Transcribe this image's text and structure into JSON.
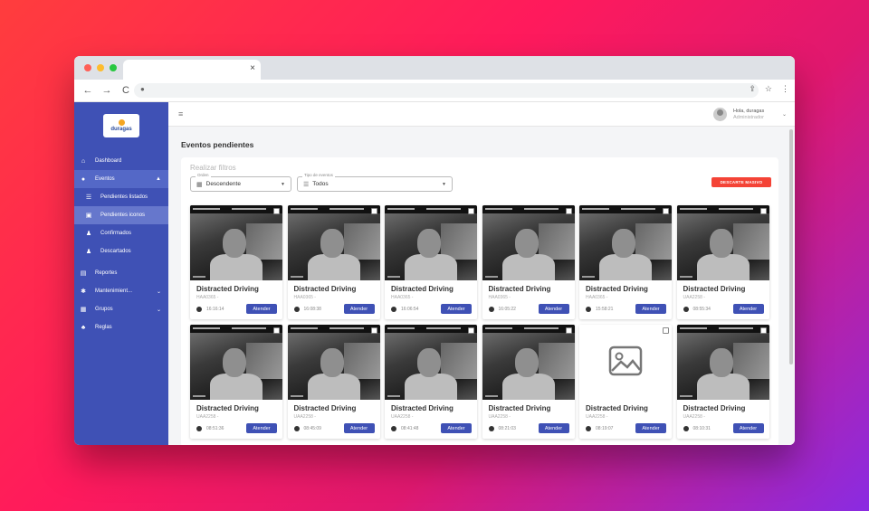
{
  "browser": {
    "tab_close": "×",
    "nav": {
      "back": "←",
      "forward": "→",
      "reload": "C"
    },
    "url_icons": {
      "share": "⇪",
      "star": "☆",
      "menu": "⋮"
    },
    "lock": "🔒"
  },
  "sidebar": {
    "logo_text": "duragas",
    "items": [
      {
        "label": "Dashboard",
        "icon": "home-icon",
        "glyph": "⌂"
      },
      {
        "label": "Eventos",
        "icon": "bell-icon",
        "glyph": "●",
        "chevron": "▲"
      },
      {
        "label": "Pendientes listados",
        "icon": "list-icon",
        "glyph": "☰"
      },
      {
        "label": "Pendientes iconos",
        "icon": "image-icon",
        "glyph": "▣"
      },
      {
        "label": "Confirmados",
        "icon": "user-check-icon",
        "glyph": "♟"
      },
      {
        "label": "Descartados",
        "icon": "user-x-icon",
        "glyph": "♟"
      },
      {
        "label": "Reportes",
        "icon": "report-icon",
        "glyph": "▤"
      },
      {
        "label": "Mantenimient...",
        "icon": "gear-icon",
        "glyph": "✱",
        "chevron": "⌄"
      },
      {
        "label": "Grupos",
        "icon": "groups-icon",
        "glyph": "▦",
        "chevron": "⌄"
      },
      {
        "label": "Reglas",
        "icon": "rules-icon",
        "glyph": "♣"
      }
    ]
  },
  "topbar": {
    "menu_glyph": "≡",
    "greeting": "Hola, duragas",
    "role": "Administrador",
    "chevron": "⌄"
  },
  "page": {
    "title": "Eventos pendientes",
    "filters_title": "Realizar filtros",
    "orden": {
      "label": "Orden",
      "value": "Descendente",
      "icon": "calendar-icon",
      "glyph": "▦",
      "caret": "▼"
    },
    "tipo": {
      "label": "Tipo de eventos",
      "value": "Todos",
      "icon": "list-icon",
      "glyph": "☰",
      "caret": "▼"
    },
    "discard_button": "DESCARTE MASIVO"
  },
  "cards": [
    {
      "title": "Distracted Driving",
      "plate": "HAA0365 -",
      "time": "16:16:14",
      "action": "Atender",
      "image": true
    },
    {
      "title": "Distracted Driving",
      "plate": "HAA0365 -",
      "time": "16:08:38",
      "action": "Atender",
      "image": true
    },
    {
      "title": "Distracted Driving",
      "plate": "HAA0365 -",
      "time": "16:06:54",
      "action": "Atender",
      "image": true
    },
    {
      "title": "Distracted Driving",
      "plate": "HAA0365 -",
      "time": "16:05:22",
      "action": "Atender",
      "image": true
    },
    {
      "title": "Distracted Driving",
      "plate": "HAA0365 -",
      "time": "15:58:21",
      "action": "Atender",
      "image": true
    },
    {
      "title": "Distracted Driving",
      "plate": "UAA2258 -",
      "time": "08:55:34",
      "action": "Atender",
      "image": true
    },
    {
      "title": "Distracted Driving",
      "plate": "UAA2258 -",
      "time": "08:51:36",
      "action": "Atender",
      "image": true
    },
    {
      "title": "Distracted Driving",
      "plate": "UAA2258 -",
      "time": "08:45:09",
      "action": "Atender",
      "image": true
    },
    {
      "title": "Distracted Driving",
      "plate": "UAA2258 -",
      "time": "08:41:48",
      "action": "Atender",
      "image": true
    },
    {
      "title": "Distracted Driving",
      "plate": "UAA2258 -",
      "time": "08:21:03",
      "action": "Atender",
      "image": true
    },
    {
      "title": "Distracted Driving",
      "plate": "UAA2258 -",
      "time": "08:19:07",
      "action": "Atender",
      "image": false
    },
    {
      "title": "Distracted Driving",
      "plate": "UAA2258 -",
      "time": "08:10:31",
      "action": "Atender",
      "image": true
    }
  ],
  "colors": {
    "primary": "#3f51b5",
    "danger": "#f44336",
    "traffic_red": "#ff5f57",
    "traffic_yellow": "#febc2e",
    "traffic_green": "#28c840"
  }
}
